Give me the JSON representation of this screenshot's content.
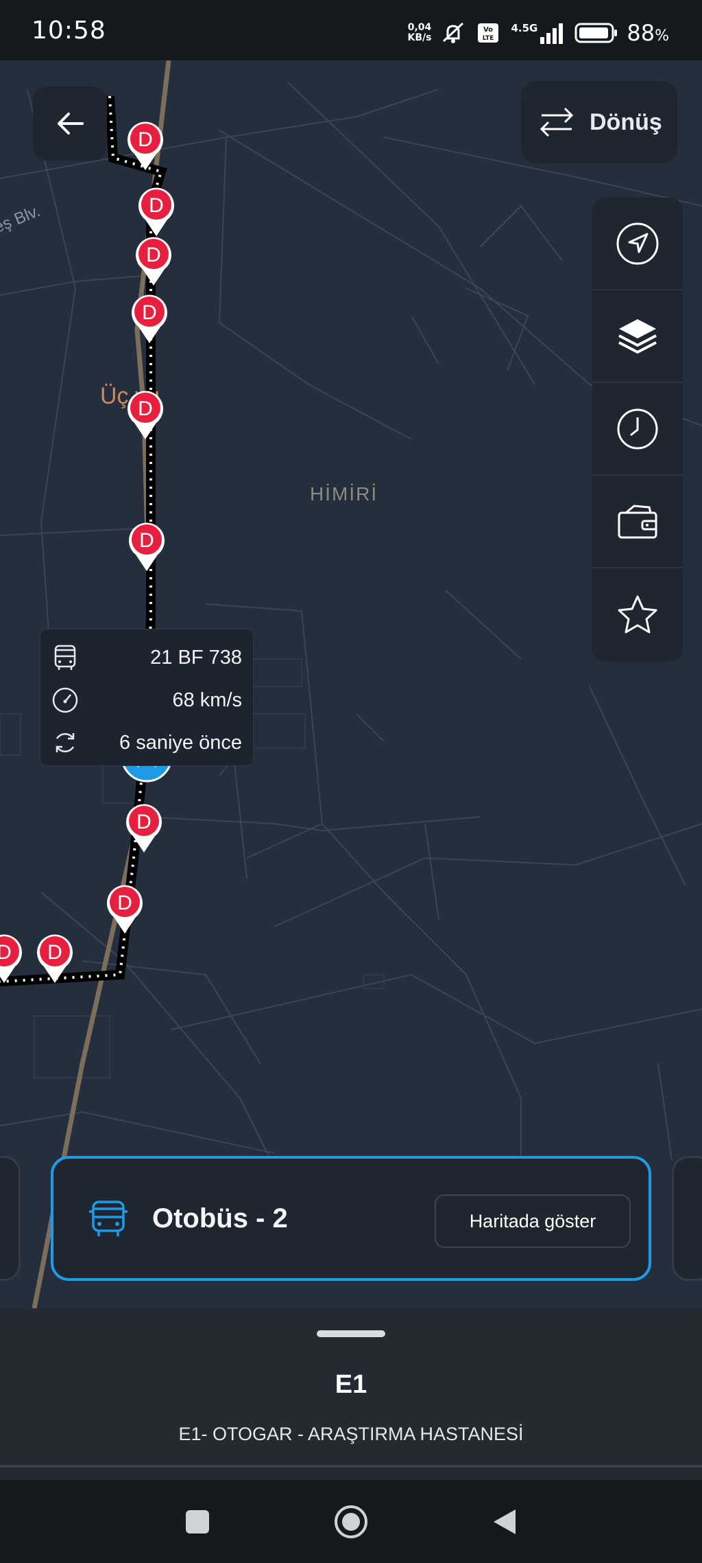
{
  "status_bar": {
    "time": "10:58",
    "net_speed_value": "0,04",
    "net_speed_unit": "KB/s",
    "network": "4.5G",
    "battery": "88",
    "battery_unit": "%"
  },
  "map": {
    "labels": {
      "district_1": "Üç  yu",
      "district_2": "HİMİRİ",
      "boulevard": "eş Blv."
    },
    "stop_marker_letter": "D",
    "colors": {
      "background": "#242e3c",
      "route": "#000000",
      "stop": "#e8203f",
      "vehicle": "#1e9be8"
    }
  },
  "header": {
    "return_label": "Dönüş"
  },
  "vehicle_popup": {
    "plate": "21 BF 738",
    "speed": "68 km/s",
    "updated": "6 saniye önce"
  },
  "bus_card": {
    "title": "Otobüs - 2",
    "show_on_map_label": "Haritada göster",
    "accent": "#1e9be8"
  },
  "route": {
    "code": "E1",
    "name": "E1- OTOGAR - ARAŞTIRMA HASTANESİ"
  }
}
